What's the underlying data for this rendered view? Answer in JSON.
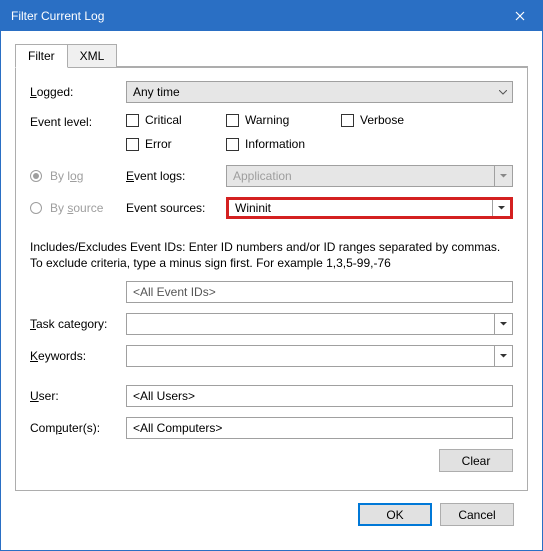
{
  "window": {
    "title": "Filter Current Log"
  },
  "tabs": {
    "filter": "Filter",
    "xml": "XML"
  },
  "labels": {
    "logged": "Logged:",
    "event_level": "Event level:",
    "by_log": "By log",
    "by_source": "By source",
    "event_logs": "Event logs:",
    "event_sources": "Event sources:",
    "task_category": "Task category:",
    "keywords": "Keywords:",
    "user": "User:",
    "computers": "Computer(s):"
  },
  "values": {
    "logged": "Any time",
    "event_logs": "Application",
    "event_sources": "Wininit",
    "event_ids": "<All Event IDs>",
    "task_category": "",
    "keywords": "",
    "user": "<All Users>",
    "computers": "<All Computers>"
  },
  "checkboxes": {
    "critical": "Critical",
    "warning": "Warning",
    "verbose": "Verbose",
    "error": "Error",
    "information": "Information"
  },
  "help_text": "Includes/Excludes Event IDs: Enter ID numbers and/or ID ranges separated by commas. To exclude criteria, type a minus sign first. For example 1,3,5-99,-76",
  "buttons": {
    "clear": "Clear",
    "ok": "OK",
    "cancel": "Cancel"
  }
}
